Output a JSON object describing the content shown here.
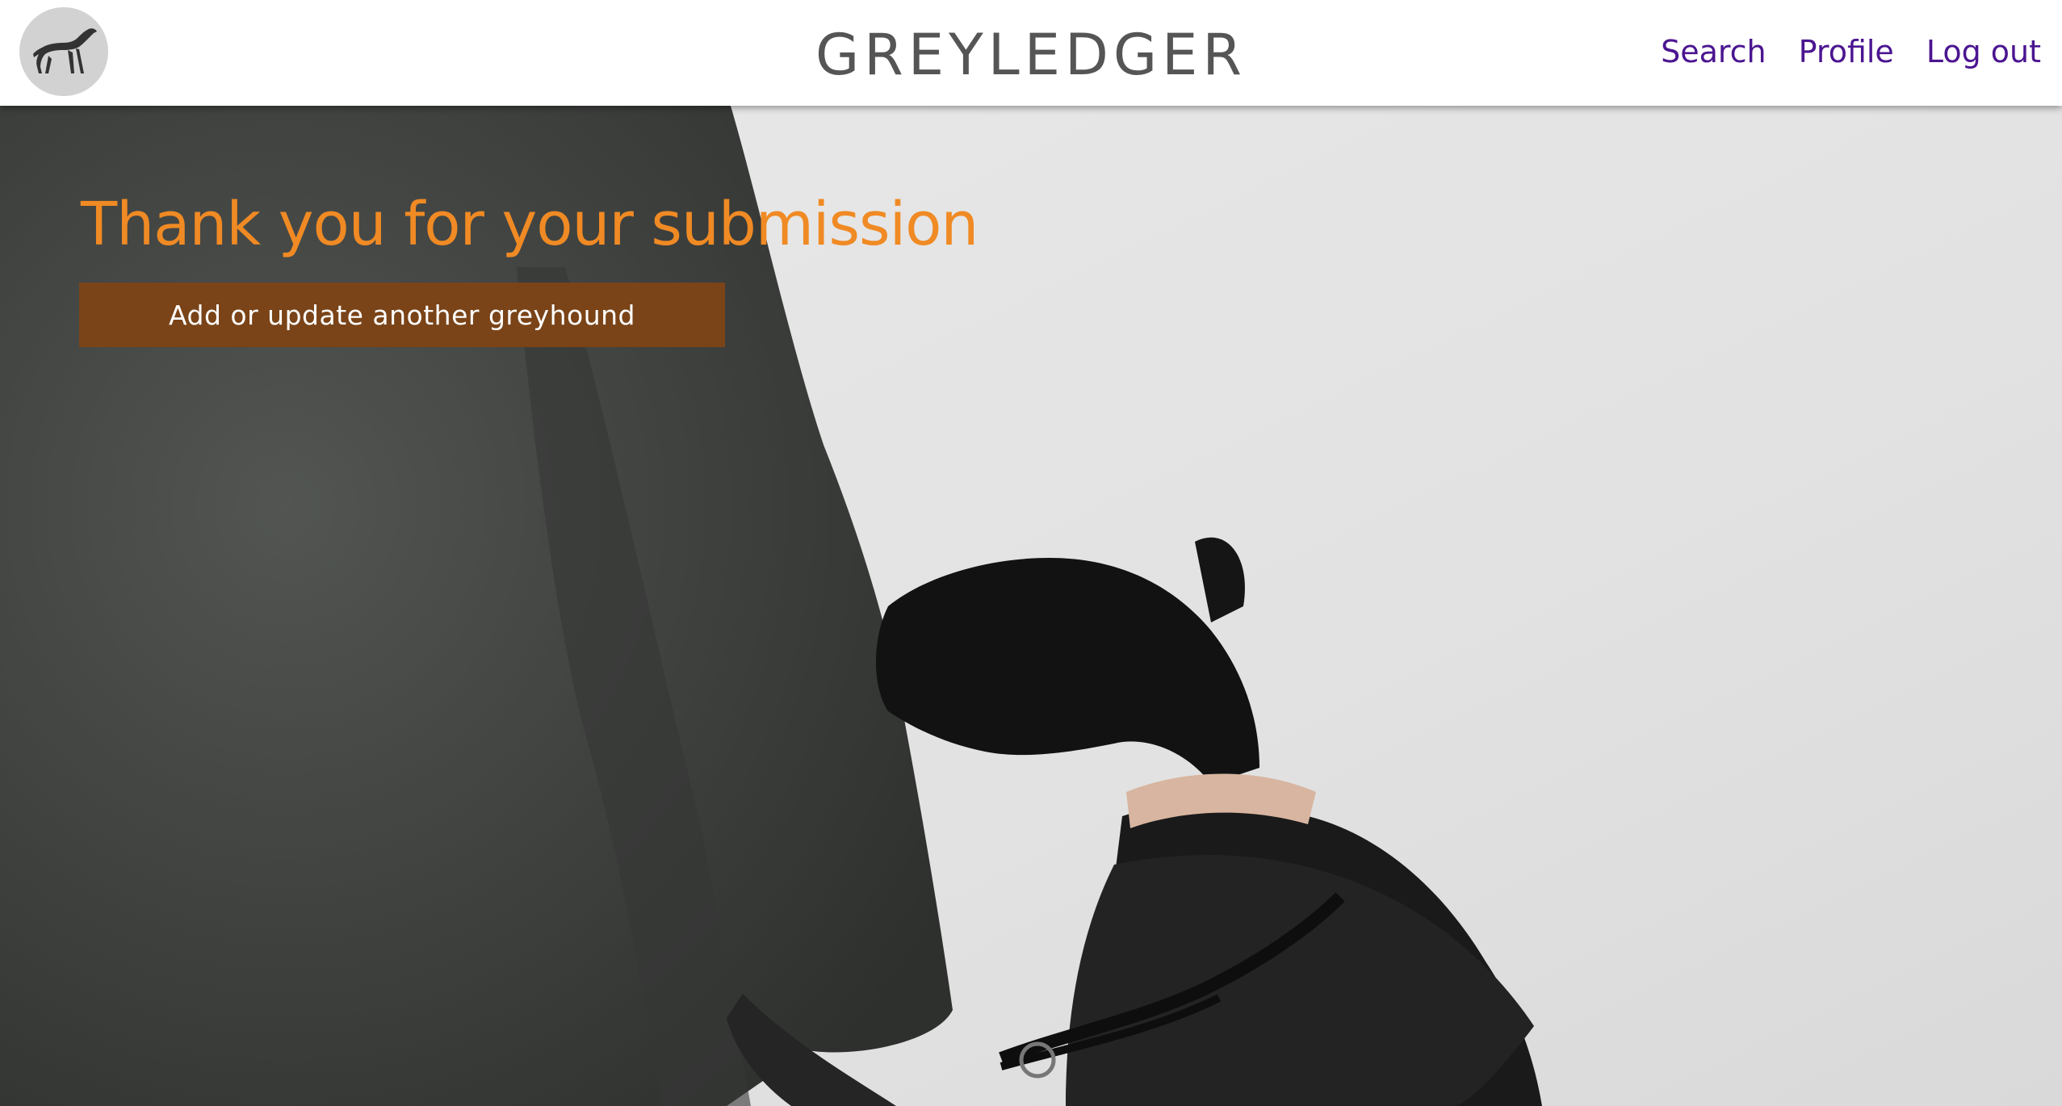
{
  "header": {
    "logo_icon": "greyhound-icon",
    "brand": "GREYLEDGER",
    "nav": [
      {
        "label": "Search"
      },
      {
        "label": "Profile"
      },
      {
        "label": "Log out"
      }
    ]
  },
  "main": {
    "heading": "Thank you for your submission",
    "cta_label": "Add or update another greyhound"
  },
  "colors": {
    "heading": "#f08a24",
    "nav_link": "#4b1590",
    "button_bg": "#7a4418",
    "header_bg": "#ffffff"
  }
}
